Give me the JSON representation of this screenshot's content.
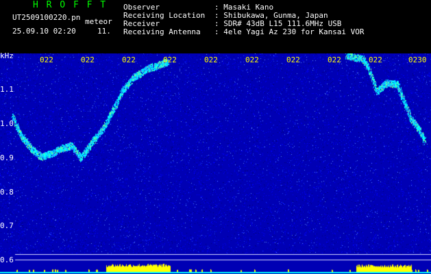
{
  "header": {
    "app_name": "H R O F F T",
    "filename": "UT2509100220.pn",
    "filename_suffix": "meteor",
    "datetime": "25.09.10 02:20",
    "count": "11.",
    "fields": [
      {
        "label": "Observer",
        "value": ": Masaki Kano"
      },
      {
        "label": "Receiving Location",
        "value": ": Shibukawa, Gunma, Japan"
      },
      {
        "label": "Receiver",
        "value": ": SDR# 43dB L15 111.6MHz USB"
      },
      {
        "label": "Receiving Antenna",
        "value": ": 4ele Yagi Az 230 for Kansai VOR"
      }
    ]
  },
  "spectrogram": {
    "unit_label": "kHz",
    "y_ticks": [
      "1.1",
      "1.0",
      "0.9",
      "0.8",
      "0.7",
      "0.6"
    ],
    "x_ticks": [
      "022",
      "022",
      "022",
      "022",
      "022",
      "022",
      "022",
      "022",
      "022",
      "0230"
    ],
    "colors": {
      "background": "#0000c8",
      "trace": "#00ffff",
      "amplitude": "#ffff00",
      "text": "#ffffff",
      "title": "#00ff00",
      "time_labels": "#ffff00"
    }
  }
}
